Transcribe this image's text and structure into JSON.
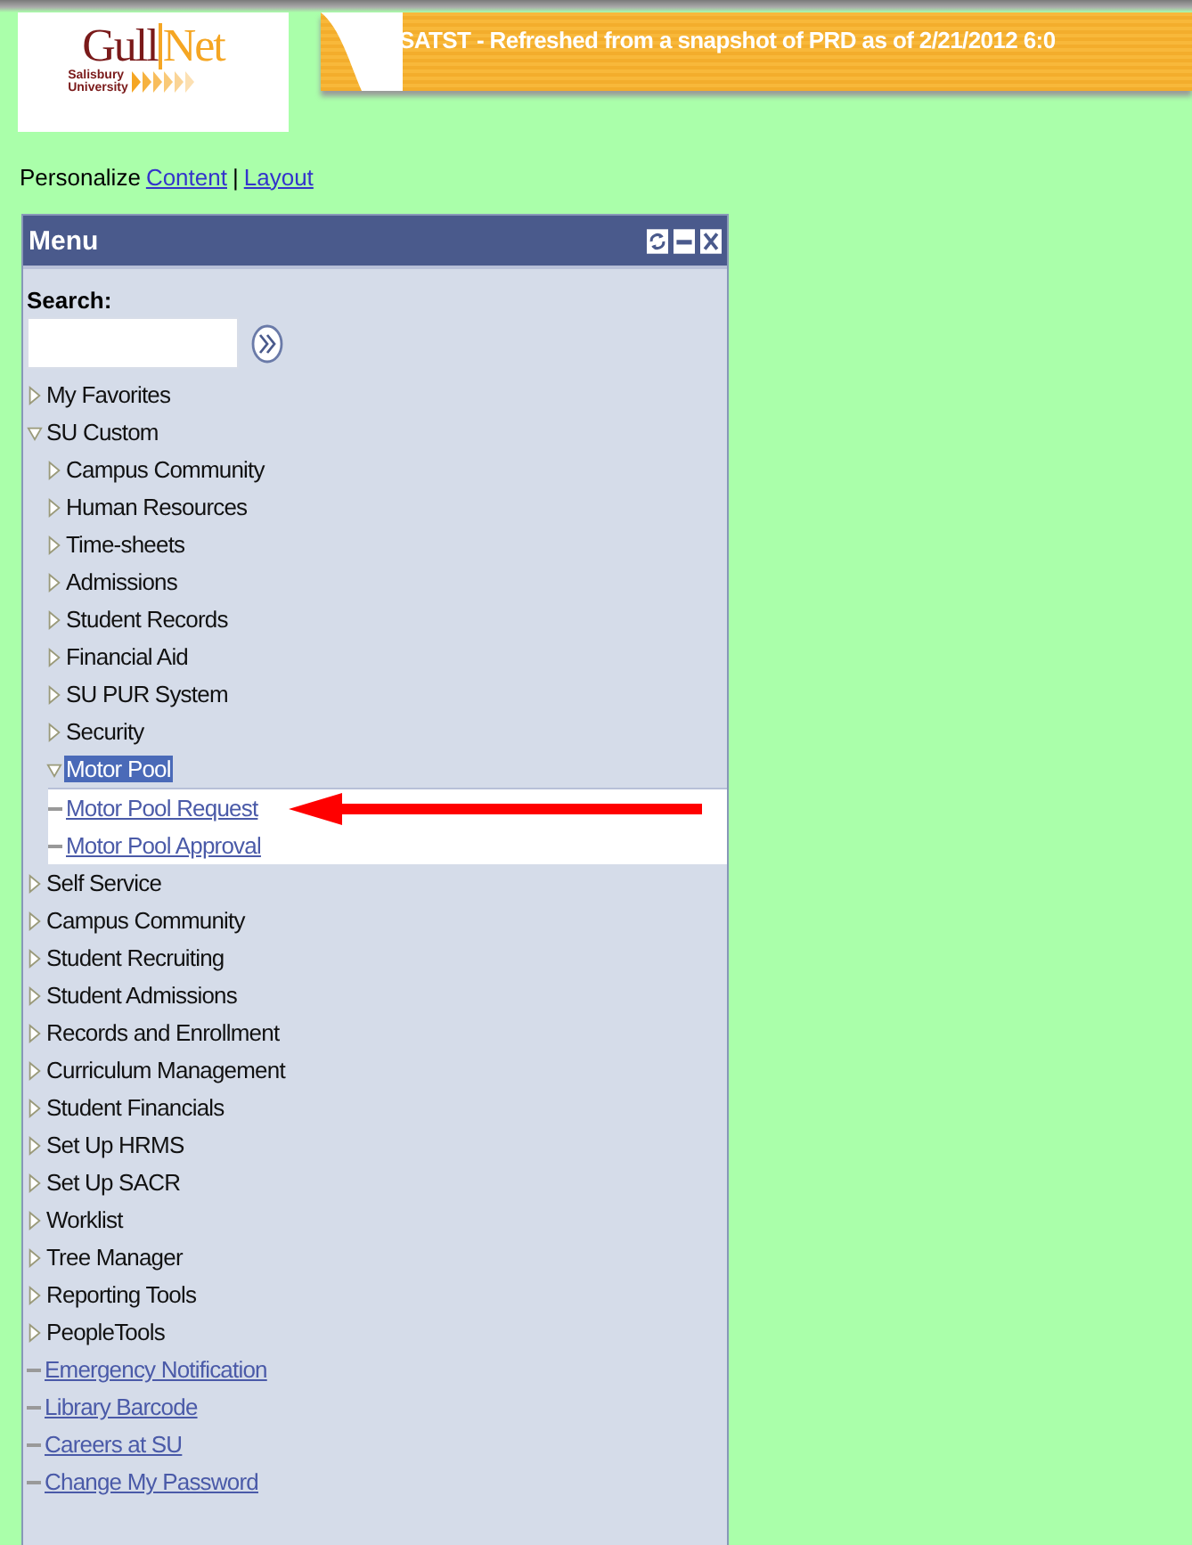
{
  "logo": {
    "name_first": "Gull",
    "name_second": "Net",
    "line_1": "Salisbury",
    "line_2": "University"
  },
  "banner": {
    "text": "SATST - Refreshed from a snapshot of PRD as of 2/21/2012 6:0"
  },
  "personalize": {
    "label": "Personalize",
    "links": [
      "Content",
      "Layout"
    ],
    "separator": "|"
  },
  "menu": {
    "title": "Menu",
    "search_label": "Search:",
    "items": [
      {
        "kind": "folder",
        "label": "My Favorites",
        "expanded": false,
        "selected": false
      },
      {
        "kind": "folder",
        "label": "SU Custom",
        "expanded": true,
        "selected": false,
        "children": [
          {
            "kind": "folder",
            "label": "Campus Community",
            "expanded": false,
            "selected": false
          },
          {
            "kind": "folder",
            "label": "Human Resources",
            "expanded": false,
            "selected": false
          },
          {
            "kind": "folder",
            "label": "Time-sheets",
            "expanded": false,
            "selected": false
          },
          {
            "kind": "folder",
            "label": "Admissions",
            "expanded": false,
            "selected": false
          },
          {
            "kind": "folder",
            "label": "Student Records",
            "expanded": false,
            "selected": false
          },
          {
            "kind": "folder",
            "label": "Financial Aid",
            "expanded": false,
            "selected": false
          },
          {
            "kind": "folder",
            "label": "SU PUR System",
            "expanded": false,
            "selected": false
          },
          {
            "kind": "folder",
            "label": "Security",
            "expanded": false,
            "selected": false
          },
          {
            "kind": "folder",
            "label": "Motor Pool",
            "expanded": true,
            "selected": true,
            "children": [
              {
                "kind": "link",
                "label": "Motor Pool Request",
                "selected": false
              },
              {
                "kind": "link",
                "label": "Motor Pool Approval",
                "selected": false
              }
            ]
          }
        ]
      },
      {
        "kind": "folder",
        "label": "Self Service",
        "expanded": false,
        "selected": false
      },
      {
        "kind": "folder",
        "label": "Campus Community",
        "expanded": false,
        "selected": false
      },
      {
        "kind": "folder",
        "label": "Student Recruiting",
        "expanded": false,
        "selected": false
      },
      {
        "kind": "folder",
        "label": "Student Admissions",
        "expanded": false,
        "selected": false
      },
      {
        "kind": "folder",
        "label": "Records and Enrollment",
        "expanded": false,
        "selected": false
      },
      {
        "kind": "folder",
        "label": "Curriculum Management",
        "expanded": false,
        "selected": false
      },
      {
        "kind": "folder",
        "label": "Student Financials",
        "expanded": false,
        "selected": false
      },
      {
        "kind": "folder",
        "label": "Set Up HRMS",
        "expanded": false,
        "selected": false
      },
      {
        "kind": "folder",
        "label": "Set Up SACR",
        "expanded": false,
        "selected": false
      },
      {
        "kind": "folder",
        "label": "Worklist",
        "expanded": false,
        "selected": false
      },
      {
        "kind": "folder",
        "label": "Tree Manager",
        "expanded": false,
        "selected": false
      },
      {
        "kind": "folder",
        "label": "Reporting Tools",
        "expanded": false,
        "selected": false
      },
      {
        "kind": "folder",
        "label": "PeopleTools",
        "expanded": false,
        "selected": false
      },
      {
        "kind": "link",
        "label": "Emergency Notification",
        "selected": false
      },
      {
        "kind": "link",
        "label": "Library Barcode",
        "selected": false
      },
      {
        "kind": "link",
        "label": "Careers at SU",
        "selected": false
      },
      {
        "kind": "link",
        "label": "Change My Password",
        "selected": false
      }
    ]
  }
}
